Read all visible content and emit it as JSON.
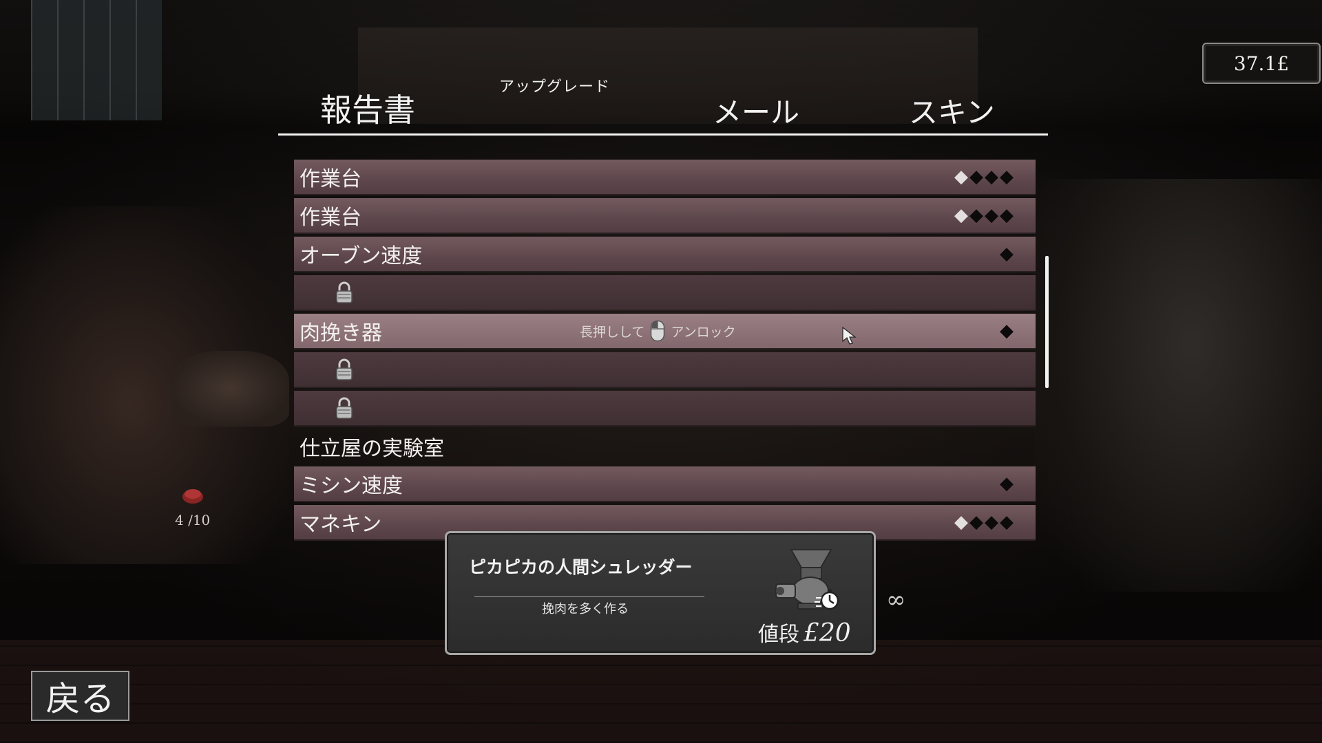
{
  "money": "37.1£",
  "tabs": {
    "report": "報告書",
    "upgrade": "アップグレード",
    "mail": "メール",
    "skin": "スキン"
  },
  "rows": [
    {
      "label": "作業台",
      "diamonds_hollow": "◆",
      "diamonds_filled": "◆◆◆"
    },
    {
      "label": "作業台",
      "diamonds_hollow": "◆",
      "diamonds_filled": "◆◆◆"
    },
    {
      "label": "オーブン速度",
      "diamonds_hollow": "",
      "diamonds_filled": "◆"
    },
    {
      "label": "",
      "locked": true
    },
    {
      "label": "肉挽き器",
      "diamonds_hollow": "",
      "diamonds_filled": "◆",
      "hint_before": "長押しして",
      "hint_after": "アンロック"
    },
    {
      "label": "",
      "locked": true
    },
    {
      "label": "",
      "locked": true
    },
    {
      "label": "仕立屋の実験室",
      "section": true
    },
    {
      "label": "ミシン速度",
      "diamonds_hollow": "",
      "diamonds_filled": "◆"
    },
    {
      "label": "マネキン",
      "diamonds_hollow": "◆",
      "diamonds_filled": "◆◆◆"
    }
  ],
  "counter": "4 /10",
  "tooltip": {
    "title": "ピカピカの人間シュレッダー",
    "description": "挽肉を多く作る",
    "price_label": "値段",
    "price_amount": "£20"
  },
  "infinity": "∞",
  "back_label": "戻る",
  "colors": {
    "row": "#6a5156",
    "row_highlight": "#8f7479",
    "row_locked": "#463438"
  }
}
